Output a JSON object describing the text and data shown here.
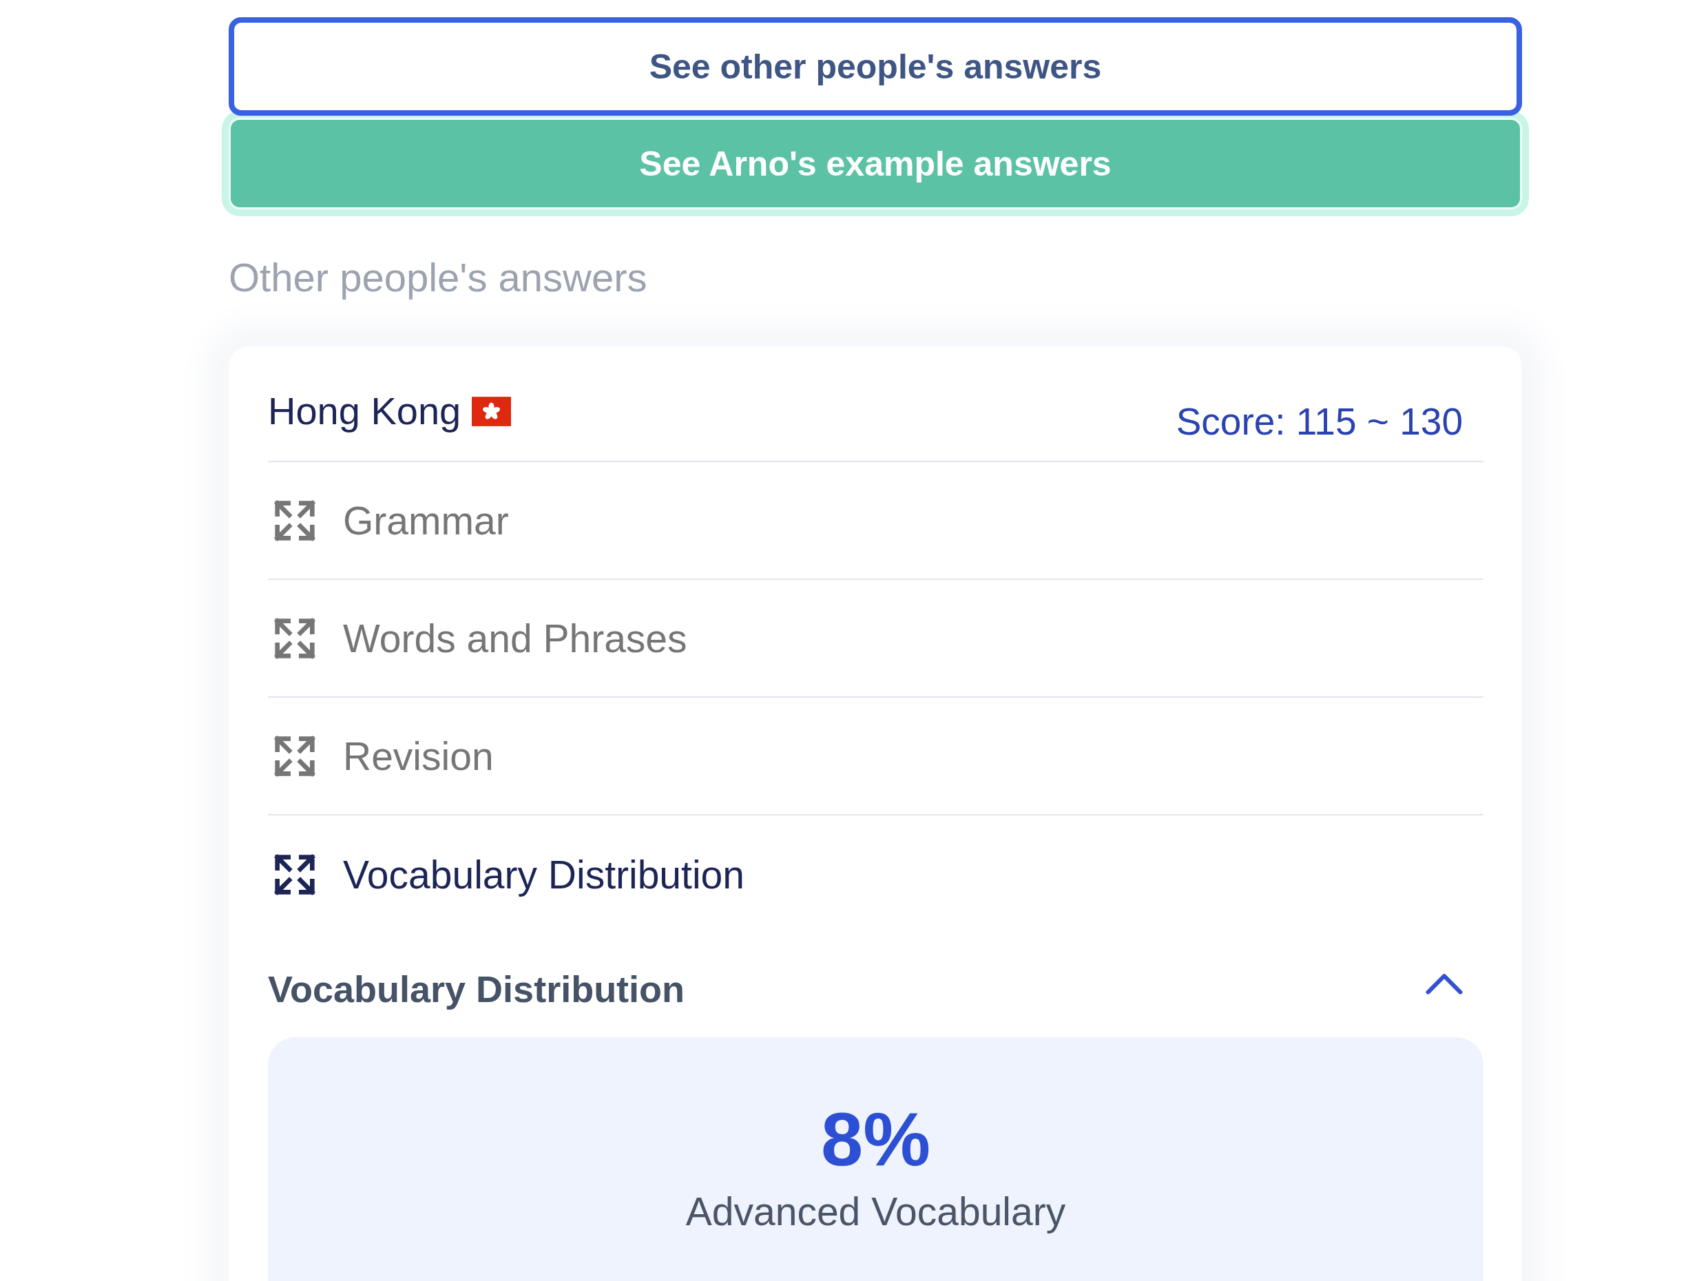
{
  "buttons": [
    {
      "kind": "outline",
      "label": "See other people's answers"
    },
    {
      "kind": "filled",
      "label": "See Arno's example answers"
    }
  ],
  "section_title": "Other people's answers",
  "answer_card": {
    "region": "Hong Kong",
    "score": "Score: 115 ~ 130",
    "categories": [
      {
        "label": "Grammar",
        "selected": false
      },
      {
        "label": "Words and Phrases",
        "selected": false
      },
      {
        "label": "Revision",
        "selected": false
      },
      {
        "label": "Vocabulary Distribution",
        "selected": true
      }
    ],
    "detail": {
      "title": "Vocabulary Distribution",
      "expanded": true,
      "value": "8%",
      "value_label": "Advanced Vocabulary"
    }
  }
}
